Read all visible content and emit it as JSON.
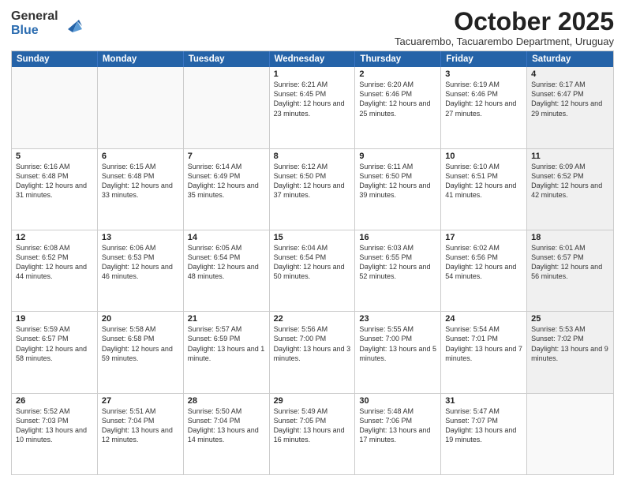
{
  "logo": {
    "general": "General",
    "blue": "Blue"
  },
  "title": "October 2025",
  "subtitle": "Tacuarembo, Tacuarembo Department, Uruguay",
  "headers": [
    "Sunday",
    "Monday",
    "Tuesday",
    "Wednesday",
    "Thursday",
    "Friday",
    "Saturday"
  ],
  "rows": [
    [
      {
        "day": "",
        "text": "",
        "empty": true
      },
      {
        "day": "",
        "text": "",
        "empty": true
      },
      {
        "day": "",
        "text": "",
        "empty": true
      },
      {
        "day": "1",
        "text": "Sunrise: 6:21 AM\nSunset: 6:45 PM\nDaylight: 12 hours\nand 23 minutes."
      },
      {
        "day": "2",
        "text": "Sunrise: 6:20 AM\nSunset: 6:46 PM\nDaylight: 12 hours\nand 25 minutes."
      },
      {
        "day": "3",
        "text": "Sunrise: 6:19 AM\nSunset: 6:46 PM\nDaylight: 12 hours\nand 27 minutes."
      },
      {
        "day": "4",
        "text": "Sunrise: 6:17 AM\nSunset: 6:47 PM\nDaylight: 12 hours\nand 29 minutes.",
        "shaded": true
      }
    ],
    [
      {
        "day": "5",
        "text": "Sunrise: 6:16 AM\nSunset: 6:48 PM\nDaylight: 12 hours\nand 31 minutes."
      },
      {
        "day": "6",
        "text": "Sunrise: 6:15 AM\nSunset: 6:48 PM\nDaylight: 12 hours\nand 33 minutes."
      },
      {
        "day": "7",
        "text": "Sunrise: 6:14 AM\nSunset: 6:49 PM\nDaylight: 12 hours\nand 35 minutes."
      },
      {
        "day": "8",
        "text": "Sunrise: 6:12 AM\nSunset: 6:50 PM\nDaylight: 12 hours\nand 37 minutes."
      },
      {
        "day": "9",
        "text": "Sunrise: 6:11 AM\nSunset: 6:50 PM\nDaylight: 12 hours\nand 39 minutes."
      },
      {
        "day": "10",
        "text": "Sunrise: 6:10 AM\nSunset: 6:51 PM\nDaylight: 12 hours\nand 41 minutes."
      },
      {
        "day": "11",
        "text": "Sunrise: 6:09 AM\nSunset: 6:52 PM\nDaylight: 12 hours\nand 42 minutes.",
        "shaded": true
      }
    ],
    [
      {
        "day": "12",
        "text": "Sunrise: 6:08 AM\nSunset: 6:52 PM\nDaylight: 12 hours\nand 44 minutes."
      },
      {
        "day": "13",
        "text": "Sunrise: 6:06 AM\nSunset: 6:53 PM\nDaylight: 12 hours\nand 46 minutes."
      },
      {
        "day": "14",
        "text": "Sunrise: 6:05 AM\nSunset: 6:54 PM\nDaylight: 12 hours\nand 48 minutes."
      },
      {
        "day": "15",
        "text": "Sunrise: 6:04 AM\nSunset: 6:54 PM\nDaylight: 12 hours\nand 50 minutes."
      },
      {
        "day": "16",
        "text": "Sunrise: 6:03 AM\nSunset: 6:55 PM\nDaylight: 12 hours\nand 52 minutes."
      },
      {
        "day": "17",
        "text": "Sunrise: 6:02 AM\nSunset: 6:56 PM\nDaylight: 12 hours\nand 54 minutes."
      },
      {
        "day": "18",
        "text": "Sunrise: 6:01 AM\nSunset: 6:57 PM\nDaylight: 12 hours\nand 56 minutes.",
        "shaded": true
      }
    ],
    [
      {
        "day": "19",
        "text": "Sunrise: 5:59 AM\nSunset: 6:57 PM\nDaylight: 12 hours\nand 58 minutes."
      },
      {
        "day": "20",
        "text": "Sunrise: 5:58 AM\nSunset: 6:58 PM\nDaylight: 12 hours\nand 59 minutes."
      },
      {
        "day": "21",
        "text": "Sunrise: 5:57 AM\nSunset: 6:59 PM\nDaylight: 13 hours\nand 1 minute."
      },
      {
        "day": "22",
        "text": "Sunrise: 5:56 AM\nSunset: 7:00 PM\nDaylight: 13 hours\nand 3 minutes."
      },
      {
        "day": "23",
        "text": "Sunrise: 5:55 AM\nSunset: 7:00 PM\nDaylight: 13 hours\nand 5 minutes."
      },
      {
        "day": "24",
        "text": "Sunrise: 5:54 AM\nSunset: 7:01 PM\nDaylight: 13 hours\nand 7 minutes."
      },
      {
        "day": "25",
        "text": "Sunrise: 5:53 AM\nSunset: 7:02 PM\nDaylight: 13 hours\nand 9 minutes.",
        "shaded": true
      }
    ],
    [
      {
        "day": "26",
        "text": "Sunrise: 5:52 AM\nSunset: 7:03 PM\nDaylight: 13 hours\nand 10 minutes."
      },
      {
        "day": "27",
        "text": "Sunrise: 5:51 AM\nSunset: 7:04 PM\nDaylight: 13 hours\nand 12 minutes."
      },
      {
        "day": "28",
        "text": "Sunrise: 5:50 AM\nSunset: 7:04 PM\nDaylight: 13 hours\nand 14 minutes."
      },
      {
        "day": "29",
        "text": "Sunrise: 5:49 AM\nSunset: 7:05 PM\nDaylight: 13 hours\nand 16 minutes."
      },
      {
        "day": "30",
        "text": "Sunrise: 5:48 AM\nSunset: 7:06 PM\nDaylight: 13 hours\nand 17 minutes."
      },
      {
        "day": "31",
        "text": "Sunrise: 5:47 AM\nSunset: 7:07 PM\nDaylight: 13 hours\nand 19 minutes."
      },
      {
        "day": "",
        "text": "",
        "empty": true,
        "shaded": true
      }
    ]
  ]
}
